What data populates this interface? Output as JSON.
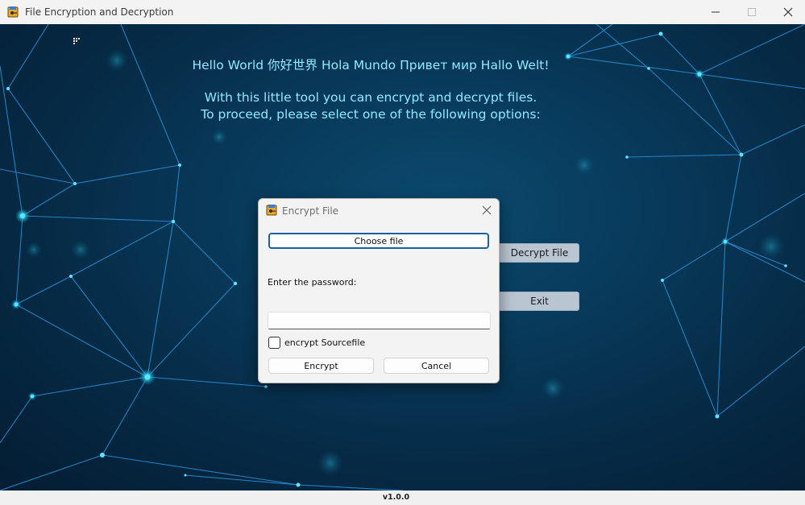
{
  "window": {
    "title": "File Encryption and Decryption",
    "icon": "app-key-file-icon",
    "controls": [
      "minimize-icon",
      "maximize-icon",
      "close-icon"
    ]
  },
  "main": {
    "greeting": "Hello World 你好世界 Hola Mundo Привет мир Hallo Welt!",
    "description_line1": "With this little tool you can encrypt and decrypt files.",
    "description_line2": "To proceed, please select one of the following options:",
    "buttons": {
      "decrypt_partial": "Decrypt File",
      "exit": "Exit"
    }
  },
  "status": {
    "version": "v1.0.0"
  },
  "dialog": {
    "title": "Encrypt File",
    "choose_file": "Choose file",
    "password_label": "Enter the password:",
    "password_value": "",
    "checkbox_label": "encrypt Sourcefile",
    "checkbox_checked": false,
    "encrypt_button": "Encrypt",
    "cancel_button": "Cancel"
  },
  "colors": {
    "accent_text": "#8fe9ff",
    "background": "#062a45",
    "dialog_focus_border": "#1c5fa8"
  }
}
